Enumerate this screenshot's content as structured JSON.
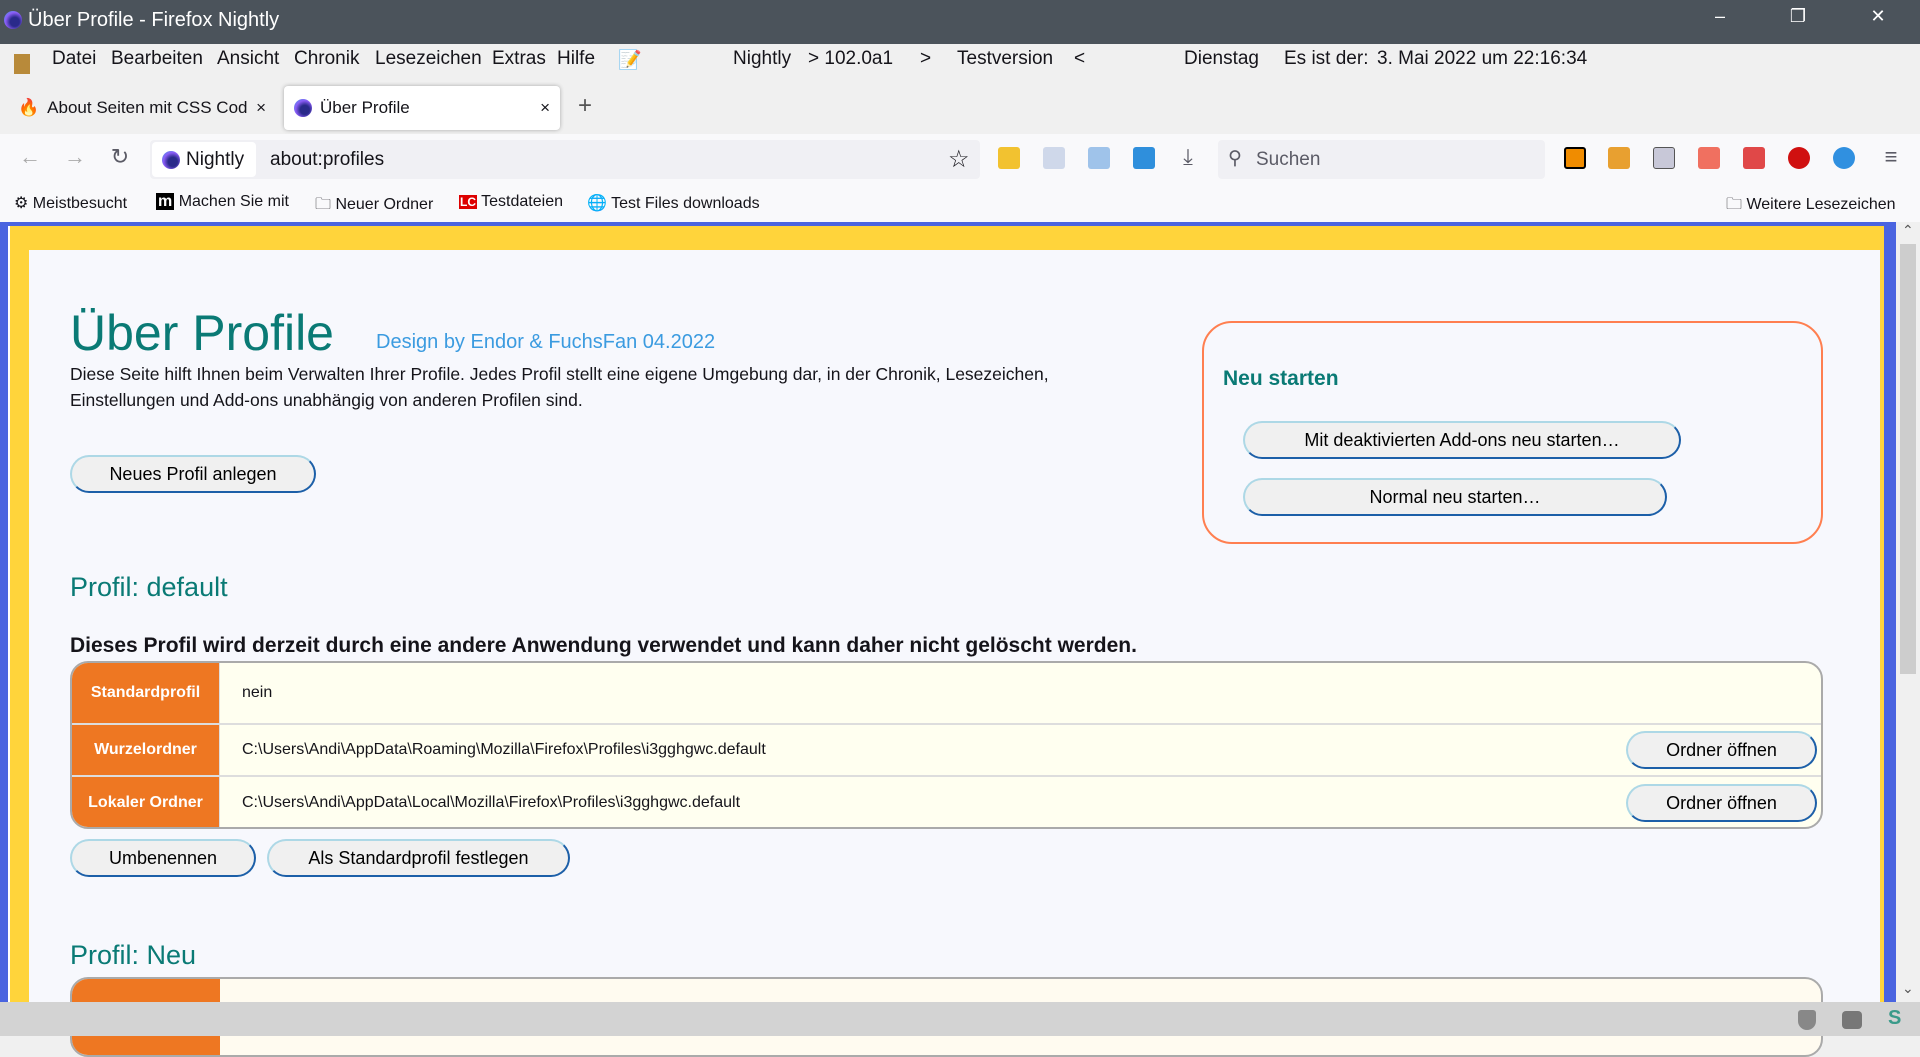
{
  "window": {
    "title": "Über Profile - Firefox Nightly",
    "minimize": "–",
    "restore": "❐",
    "close": "✕"
  },
  "menu": {
    "items": [
      "Datei",
      "Bearbeiten",
      "Ansicht",
      "Chronik",
      "Lesezeichen",
      "Extras",
      "Hilfe"
    ],
    "nightly": "Nightly",
    "version": "> 102.0a1",
    "gt": ">",
    "testversion": "Testversion",
    "lt": "<",
    "day": "Dienstag",
    "date_label": "Es ist der:",
    "date": "3. Mai 2022 um 22:16:34"
  },
  "tabs": [
    {
      "label": "About Seiten mit CSS Code",
      "close": "×"
    },
    {
      "label": "Über Profile",
      "close": "×"
    }
  ],
  "new_tab": "+",
  "nav": {
    "back": "←",
    "forward": "→",
    "reload": "↻",
    "identity": "Nightly",
    "url": "about:profiles",
    "star": "☆",
    "download": "⤓",
    "search_placeholder": "Suchen",
    "menu": "≡"
  },
  "bookmarks": [
    "Meistbesucht",
    "Machen Sie mit",
    "Neuer Ordner",
    "Testdateien",
    "Test Files downloads"
  ],
  "other_bookmarks": "Weitere Lesezeichen",
  "page": {
    "title": "Über Profile",
    "credit": "Design by Endor & FuchsFan 04.2022",
    "intro_1": "Diese Seite hilft Ihnen beim Verwalten Ihrer Profile. Jedes Profil stellt eine eigene Umgebung dar, in der Chronik, Lesezeichen,",
    "intro_2": "Einstellungen und Add-ons unabhängig von anderen Profilen sind.",
    "new_profile": "Neues Profil anlegen",
    "restart": {
      "title": "Neu starten",
      "safe": "Mit deaktivierten Add-ons neu starten…",
      "normal": "Normal neu starten…"
    },
    "profile_default": {
      "heading": "Profil: default",
      "warning": "Dieses Profil wird derzeit durch eine andere Anwendung verwendet und kann daher nicht gelöscht werden.",
      "rows": [
        {
          "label": "Standardprofil",
          "value": "nein"
        },
        {
          "label": "Wurzelordner",
          "value": "C:\\Users\\Andi\\AppData\\Roaming\\Mozilla\\Firefox\\Profiles\\i3gghgwc.default",
          "button": "Ordner öffnen"
        },
        {
          "label": "Lokaler Ordner",
          "value": "C:\\Users\\Andi\\AppData\\Local\\Mozilla\\Firefox\\Profiles\\i3gghgwc.default",
          "button": "Ordner öffnen"
        }
      ],
      "rename": "Umbenennen",
      "set_default": "Als Standardprofil festlegen"
    },
    "profile_neu": {
      "heading": "Profil: Neu"
    }
  },
  "colors": {
    "teal": "#0a7a75",
    "orange": "#ee7722",
    "yellow": "#ffd43b",
    "blue_frame": "#4a64e0"
  }
}
